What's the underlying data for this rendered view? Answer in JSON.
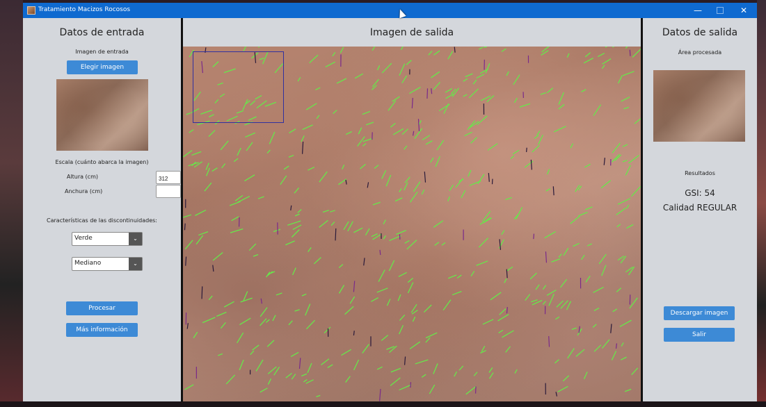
{
  "window": {
    "title": "Tratamiento Macizos Rocosos",
    "controls": {
      "minimize": "—",
      "maximize": "",
      "close": "✕"
    }
  },
  "left": {
    "heading": "Datos de entrada",
    "input_label": "Imagen de entrada",
    "choose_button": "Elegir imagen",
    "scale_label": "Escala (cuánto abarca la imagen)",
    "height_label": "Altura (cm)",
    "height_value": "312",
    "width_label": "Anchura (cm)",
    "width_value": "",
    "disc_label": "Características de las discontinuidades:",
    "color_select": "Verde",
    "size_select": "Mediano",
    "process_button": "Procesar",
    "more_button": "Más información"
  },
  "center": {
    "heading": "Imagen de salida"
  },
  "right": {
    "heading": "Datos de salida",
    "area_label": "Área procesada",
    "results_label": "Resultados",
    "gsi": "GSI: 54",
    "quality": "Calidad REGULAR",
    "download_button": "Descargar imagen",
    "exit_button": "Salir"
  },
  "colors": {
    "titlebar": "#0f6ad0",
    "button": "#3d8ad6",
    "panel": "#d4d7dc",
    "overlay_lines": "#66e84a"
  }
}
